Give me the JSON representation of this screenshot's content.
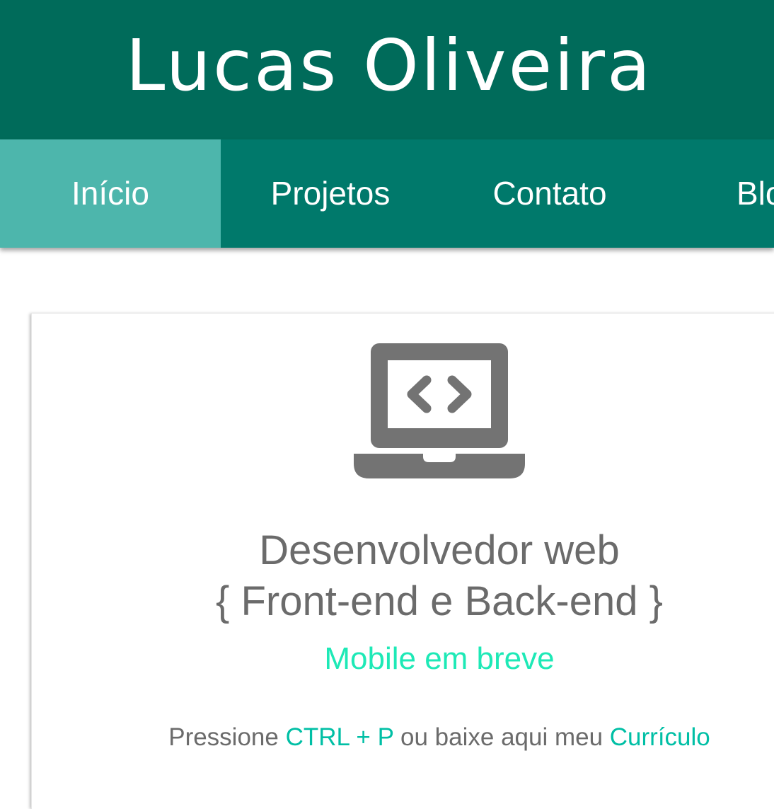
{
  "header": {
    "title": "Lucas Oliveira"
  },
  "nav": {
    "items": [
      {
        "label": "Início",
        "active": true
      },
      {
        "label": "Projetos",
        "active": false
      },
      {
        "label": "Contato",
        "active": false
      },
      {
        "label": "Blog",
        "active": false
      }
    ]
  },
  "hero": {
    "icon": "laptop-code-icon",
    "headline_line1": "Desenvolvedor web",
    "headline_line2": "{ Front-end e Back-end }",
    "mobile_note": "Mobile em breve",
    "hint_prefix": "Pressione ",
    "hint_shortcut": "CTRL + P",
    "hint_middle": " ou baixe aqui meu ",
    "hint_link": "Currículo"
  },
  "colors": {
    "header_bg": "#006b5a",
    "nav_bg": "#00796b",
    "nav_active_bg": "#4db6ac",
    "accent": "#00bfa5",
    "mobile_accent": "#1de9b6",
    "text_gray": "#6b6b6b"
  }
}
